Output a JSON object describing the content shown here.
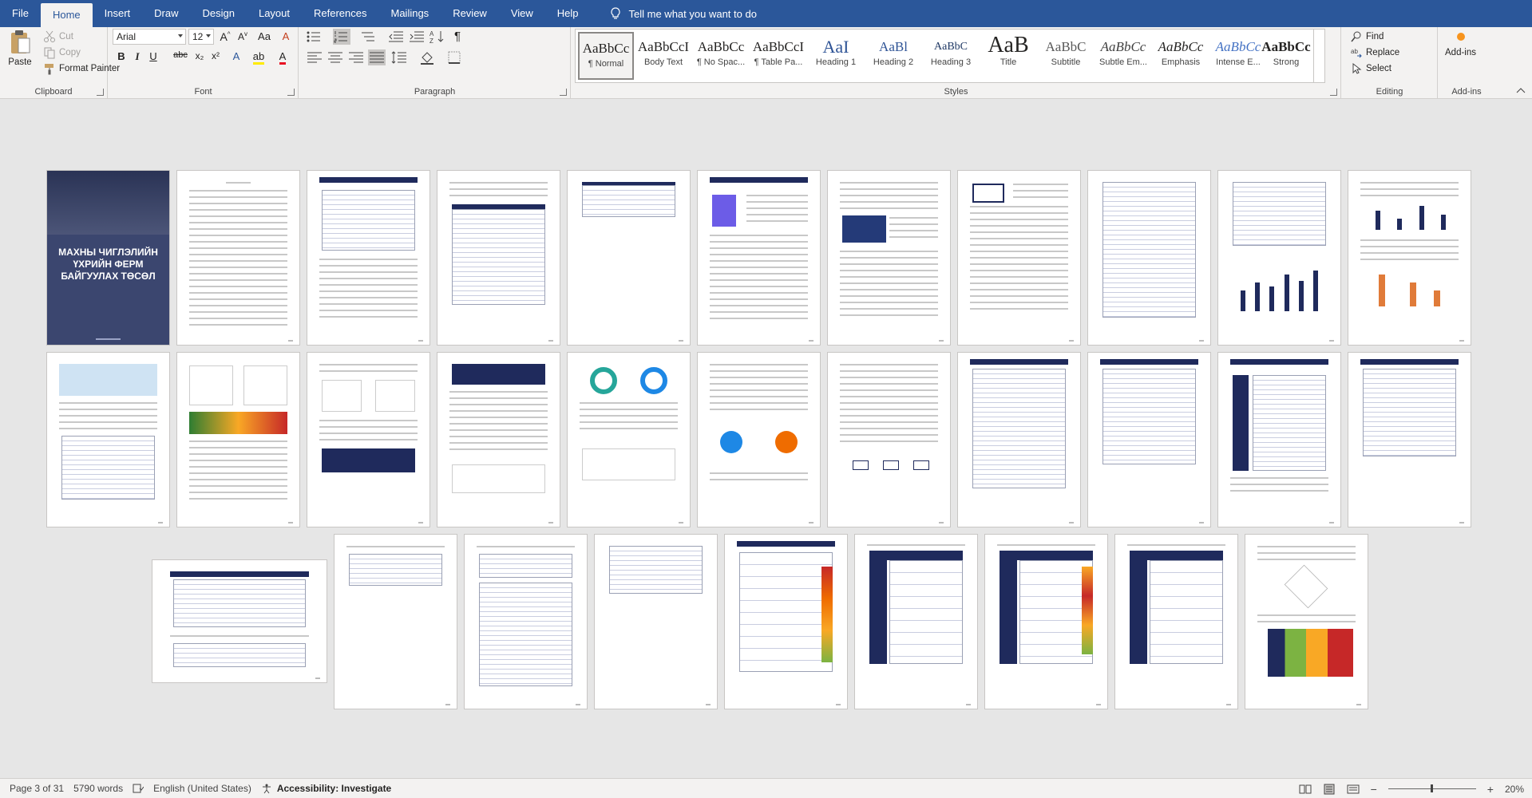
{
  "menu": {
    "tabs": [
      "File",
      "Home",
      "Insert",
      "Draw",
      "Design",
      "Layout",
      "References",
      "Mailings",
      "Review",
      "View",
      "Help"
    ],
    "active_tab": "Home",
    "tell_me": "Tell me what you want to do"
  },
  "ribbon": {
    "clipboard": {
      "paste": "Paste",
      "cut": "Cut",
      "copy": "Copy",
      "format_painter": "Format Painter",
      "label": "Clipboard"
    },
    "font": {
      "name": "Arial",
      "size": "12",
      "label": "Font",
      "bold": "B",
      "italic": "I",
      "underline": "U",
      "strike": "abc",
      "sub": "x₂",
      "sup": "x²",
      "change_case": "Aa"
    },
    "paragraph": {
      "label": "Paragraph",
      "pilcrow": "¶"
    },
    "styles": {
      "label": "Styles",
      "items": [
        {
          "sample": "AaBbCc",
          "name": "¶ Normal"
        },
        {
          "sample": "AaBbCcI",
          "name": "Body Text"
        },
        {
          "sample": "AaBbCc",
          "name": "¶ No Spac..."
        },
        {
          "sample": "AaBbCcI",
          "name": "¶ Table Pa..."
        },
        {
          "sample": "AaI",
          "name": "Heading 1"
        },
        {
          "sample": "AaBl",
          "name": "Heading 2"
        },
        {
          "sample": "AaBbC",
          "name": "Heading 3"
        },
        {
          "sample": "AaB",
          "name": "Title"
        },
        {
          "sample": "AaBbC",
          "name": "Subtitle"
        },
        {
          "sample": "AaBbCc",
          "name": "Subtle Em..."
        },
        {
          "sample": "AaBbCc",
          "name": "Emphasis"
        },
        {
          "sample": "AaBbCc",
          "name": "Intense E..."
        },
        {
          "sample": "AaBbCc",
          "name": "Strong"
        }
      ]
    },
    "editing": {
      "label": "Editing",
      "find": "Find",
      "replace": "Replace",
      "select": "Select"
    },
    "addins": {
      "label": "Add-ins",
      "button": "Add-ins"
    }
  },
  "document": {
    "cover_title": "МАХНЫ ЧИГЛЭЛИЙН ҮХРИЙН ФЕРМ БАЙГУУЛАХ ТӨСӨЛ"
  },
  "status": {
    "page": "Page 3 of 31",
    "words": "5790 words",
    "language": "English (United States)",
    "accessibility": "Accessibility: Investigate",
    "zoom": "20%",
    "zoom_fraction": 0.48
  },
  "colors": {
    "accent": "#2b579a",
    "navy": "#1f2a5c"
  }
}
